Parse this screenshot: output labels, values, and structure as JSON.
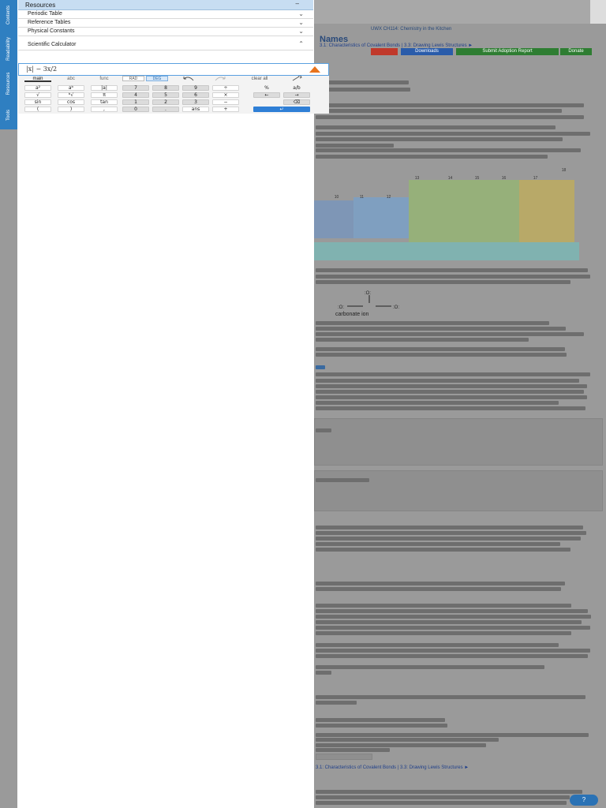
{
  "colors": {
    "tab_bar": "#2f7fc1",
    "resources_header": "#c7ddf2",
    "enter_key": "#2f7fd6",
    "display_border": "#5aa0e0"
  },
  "side_tabs": [
    {
      "label": "Contents",
      "icon": "contents-icon"
    },
    {
      "label": "Readability",
      "icon": "readability-icon"
    },
    {
      "label": "Resources",
      "icon": "resources-icon"
    },
    {
      "label": "Tools",
      "icon": "tools-icon"
    }
  ],
  "resources": {
    "title": "Resources",
    "minimize_glyph": "–",
    "close_glyph": "<",
    "items": [
      {
        "label": "Periodic Table",
        "chevron": "⌄"
      },
      {
        "label": "Reference Tables",
        "chevron": "⌄"
      },
      {
        "label": "Physical Constants",
        "chevron": "⌄"
      }
    ]
  },
  "calculator": {
    "title": "Scientific Calculator",
    "chevron": "⌃",
    "expression": "|x| − 3x/2",
    "modes": [
      "main",
      "abc",
      "func"
    ],
    "active_mode": "main",
    "angle_units": [
      "RAD",
      "DEG"
    ],
    "active_angle": "DEG",
    "clear_label": "clear all",
    "rows": [
      [
        "a²",
        "aᵇ",
        "|a|",
        "7",
        "8",
        "9",
        "÷",
        "%",
        "a/b"
      ],
      [
        "√",
        "ᵇ√",
        "π",
        "4",
        "5",
        "6",
        "×",
        "←",
        "→"
      ],
      [
        "sin",
        "cos",
        "tan",
        "1",
        "2",
        "3",
        "−",
        "",
        "⌫"
      ],
      [
        "(",
        ")",
        ",",
        "0",
        ".",
        "ans",
        "+",
        "",
        "↵"
      ]
    ]
  },
  "background_page": {
    "section_title": "Names",
    "breadcrumb": "3.1: Characteristics of Covalent Bonds | 3.3: Drawing Lewis Structures ►",
    "bottom_breadcrumb": "3.1: Characteristics of Covalent Bonds | 3.3: Drawing Lewis Structures ►",
    "course_tab": "UWX CH114: Chemistry in the Kitchen",
    "buttons": [
      "Downloads",
      "Submit Adoption Report",
      "Donate"
    ],
    "carbonate_label": "carbonate ion",
    "group_numbers": [
      "13",
      "14",
      "15",
      "16",
      "17",
      "18",
      "10",
      "11",
      "12"
    ],
    "help_label": "?"
  }
}
